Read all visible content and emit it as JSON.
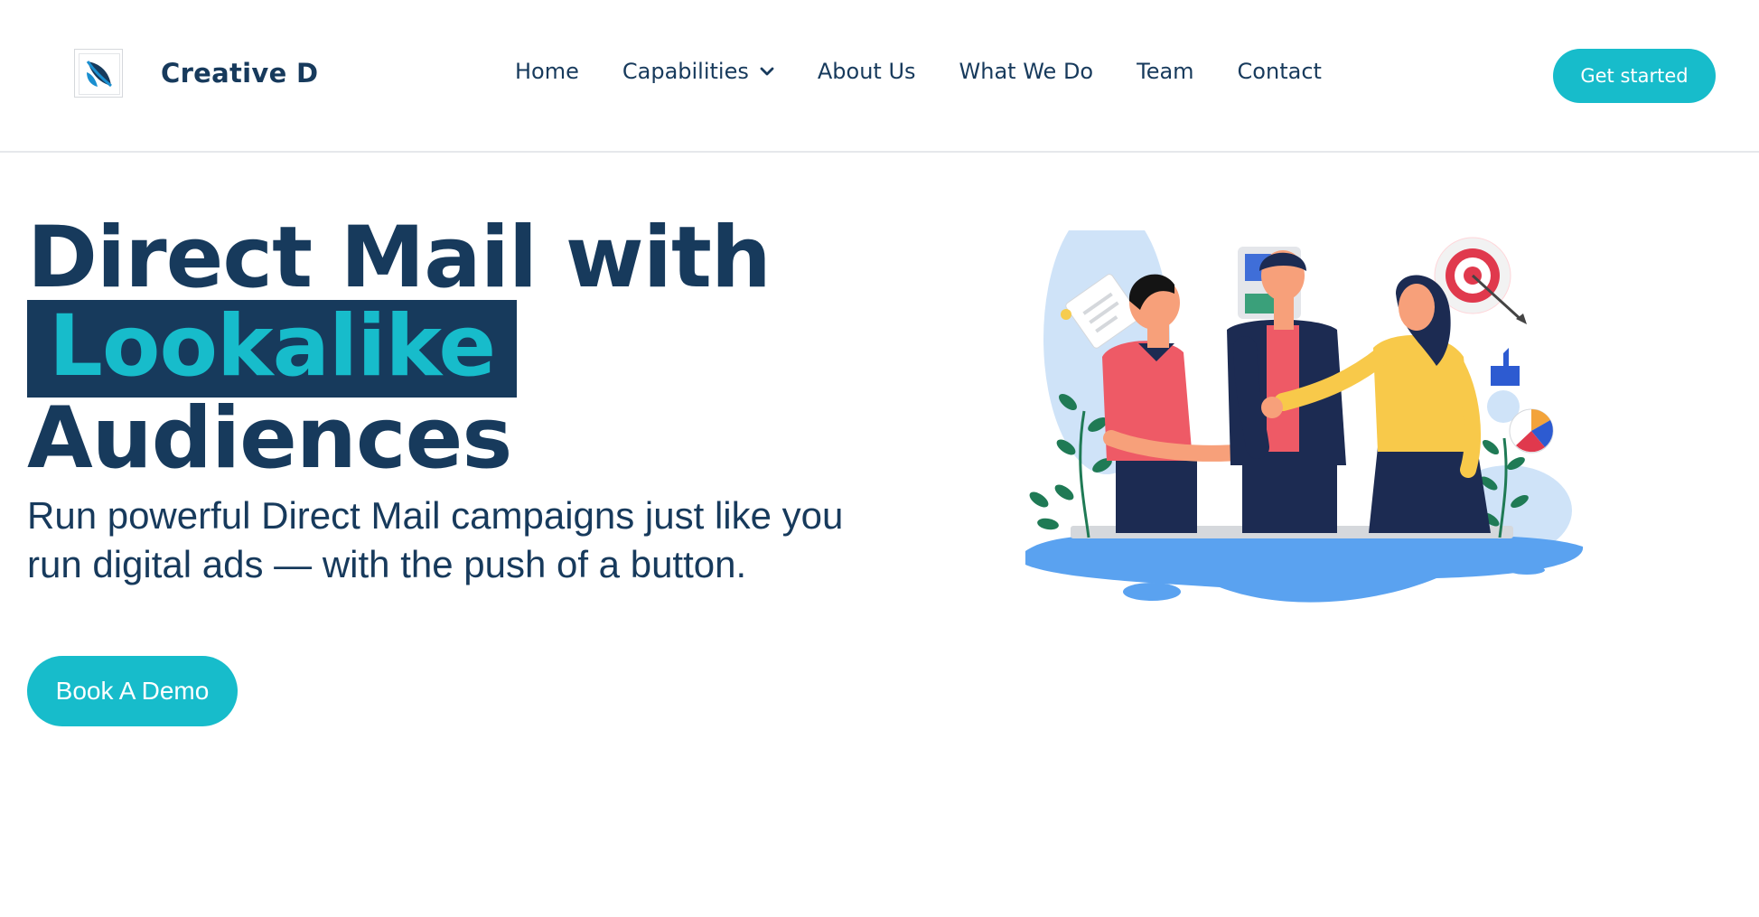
{
  "header": {
    "brand": "Creative D",
    "nav": [
      "Home",
      "Capabilities",
      "About Us",
      "What We Do",
      "Team",
      "Contact"
    ],
    "cta_label": "Get started"
  },
  "hero": {
    "title_line1": "Direct Mail with",
    "title_highlight": "Lookalike",
    "title_line3": "Audiences",
    "subtitle": "Run powerful Direct Mail campaigns just like you run digital ads — with the push of a button.",
    "cta_label": "Book A Demo"
  },
  "icons": {
    "logo": "leaf-logo-icon",
    "chevron": "chevron-down-icon",
    "illustration": "team-handshake-illustration"
  },
  "colors": {
    "navy": "#173a5c",
    "accent": "#17bccb",
    "white": "#ffffff"
  }
}
